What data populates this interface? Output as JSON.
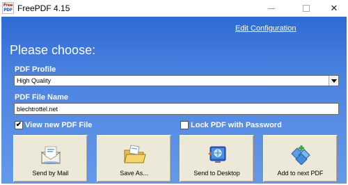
{
  "window": {
    "title": "FreePDF 4.15",
    "icon_text_1": "Free",
    "icon_text_2": "PDF",
    "minimize_icon": "minimize-icon",
    "maximize_icon": "maximize-icon",
    "close_glyph": "✕"
  },
  "header": {
    "edit_link": "Edit Configuration",
    "heading": "Please choose:"
  },
  "form": {
    "profile_label": "PDF Profile",
    "profile_value": "High Quality",
    "filename_label": "PDF File Name",
    "filename_value": "blechtrottel.net",
    "view_label": "View new PDF File",
    "view_checked": true,
    "view_mark": "✔",
    "lock_label": "Lock PDF with Password",
    "lock_checked": false,
    "lock_mark": ""
  },
  "actions": [
    {
      "label": "Send by Mail",
      "icon": "mail-envelope-icon"
    },
    {
      "label": "Save As...",
      "icon": "folder-envelope-icon"
    },
    {
      "label": "Send to Desktop",
      "icon": "desktop-globe-icon"
    },
    {
      "label": "Add to next PDF",
      "icon": "add-documents-icon"
    }
  ],
  "colors": {
    "client_top": "#2f6bd4",
    "client_bottom": "#6599ea",
    "button_face": "#ece9d8"
  }
}
